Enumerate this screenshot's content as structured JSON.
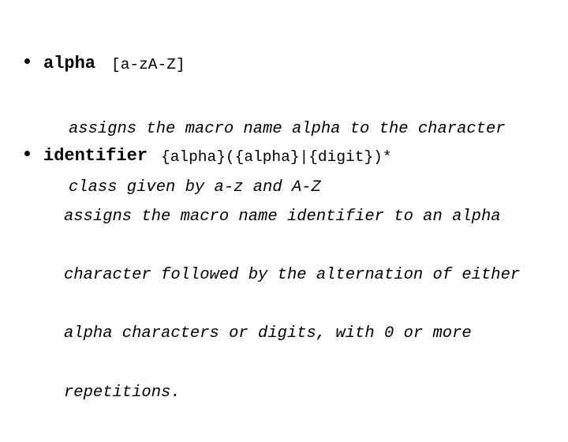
{
  "slide": {
    "background_color": "#ffffff",
    "text_color": "#000000",
    "bullet_glyph": "bullet-dot"
  },
  "bullets": [
    {
      "term": "alpha",
      "pattern": "[a-zA-Z]",
      "description_lines": [
        "assigns the macro name alpha to the character",
        "class given by a-z and A-Z"
      ]
    },
    {
      "term": "identifier",
      "pattern": "{alpha}({alpha}|{digit})*",
      "description_lines": [
        "assigns the macro name identifier to an alpha",
        "character followed by the alternation of either",
        "alpha characters or digits, with 0 or more",
        "repetitions."
      ]
    }
  ]
}
